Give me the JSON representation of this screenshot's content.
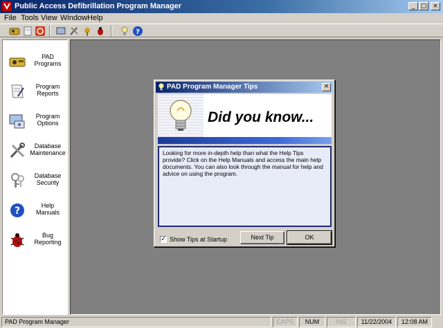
{
  "window": {
    "title": "Public Access Defibrillation Program Manager",
    "min": "_",
    "max": "□",
    "close": "×"
  },
  "menu": [
    "File",
    "Tools",
    "View",
    "Window",
    "Help"
  ],
  "sidebar": {
    "items": [
      {
        "label_line1": "PAD",
        "label_line2": "Programs",
        "icon": "defibrillator-icon"
      },
      {
        "label_line1": "Program",
        "label_line2": "Reports",
        "icon": "report-icon"
      },
      {
        "label_line1": "Program",
        "label_line2": "Options",
        "icon": "options-icon"
      },
      {
        "label_line1": "Database",
        "label_line2": "Maintenance",
        "icon": "tools-icon"
      },
      {
        "label_line1": "Database",
        "label_line2": "Security",
        "icon": "security-icon"
      },
      {
        "label_line1": "Help",
        "label_line2": "Manuals",
        "icon": "help-icon"
      },
      {
        "label_line1": "Bug",
        "label_line2": "Reporting",
        "icon": "bug-icon"
      }
    ]
  },
  "dialog": {
    "title": "PAD Program Manager Tips",
    "close": "×",
    "heading": "Did you know...",
    "tip": "Looking for more in-depth help than what the Help Tips provide? Click on the Help Manuals and access the main help documents. You can also look through the manual for help and advice on using the program.",
    "checkbox_label": "Show Tips at Startup",
    "checkbox_checked": true,
    "check_mark": "✓",
    "next_button": "Next Tip",
    "ok_button": "OK"
  },
  "status": {
    "app": "PAD Program Manager",
    "caps": "CAPS",
    "num": "NUM",
    "ins": "INS",
    "date": "11/22/2004",
    "time": "12:08 AM"
  },
  "colors": {
    "title_bar": "#0a246a",
    "desktop": "#808080",
    "tip_border": "#1e2a78"
  }
}
